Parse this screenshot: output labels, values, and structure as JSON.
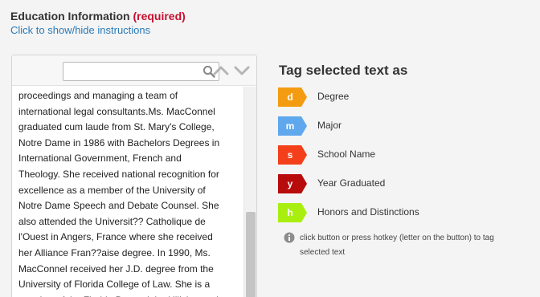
{
  "header": {
    "title": "Education Information",
    "required_label": "(required)",
    "toggle_link": "Click to show/hide instructions"
  },
  "document": {
    "search": {
      "value": "",
      "placeholder": ""
    },
    "lines": [
      "proceedings and managing a team of",
      "international legal consultants.Ms. MacConnel",
      "graduated cum laude from St. Mary's College,",
      "Notre Dame in 1986 with Bachelors Degrees in",
      "International Government, French and",
      "Theology. She received national recognition for",
      "excellence as a member of the University of",
      "Notre Dame Speech and Debate Counsel. She",
      "also attended the Universit?? Catholique de",
      "l'Ouest in Angers, France where she received",
      "her Alliance Fran??aise degree. In 1990, Ms.",
      "MacConnel received her J.D. degree from the",
      "University of Florida College of Law. She is a",
      "member of the Florida Bar and the Hillsborough"
    ]
  },
  "tags": {
    "heading": "Tag selected text as",
    "items": [
      {
        "key": "d",
        "label": "Degree",
        "color": "#f39c12"
      },
      {
        "key": "m",
        "label": "Major",
        "color": "#5fa8ee"
      },
      {
        "key": "s",
        "label": "School Name",
        "color": "#f3401b"
      },
      {
        "key": "y",
        "label": "Year Graduated",
        "color": "#b80b0b"
      },
      {
        "key": "h",
        "label": "Honors and Distinctions",
        "color": "#a8ef10"
      }
    ],
    "help_lines": [
      "click button or press hotkey (letter on the button) to tag",
      "selected text"
    ]
  },
  "icons": {
    "search": "search-icon",
    "up": "chevron-up-icon",
    "down": "chevron-down-icon",
    "info": "info-icon"
  }
}
